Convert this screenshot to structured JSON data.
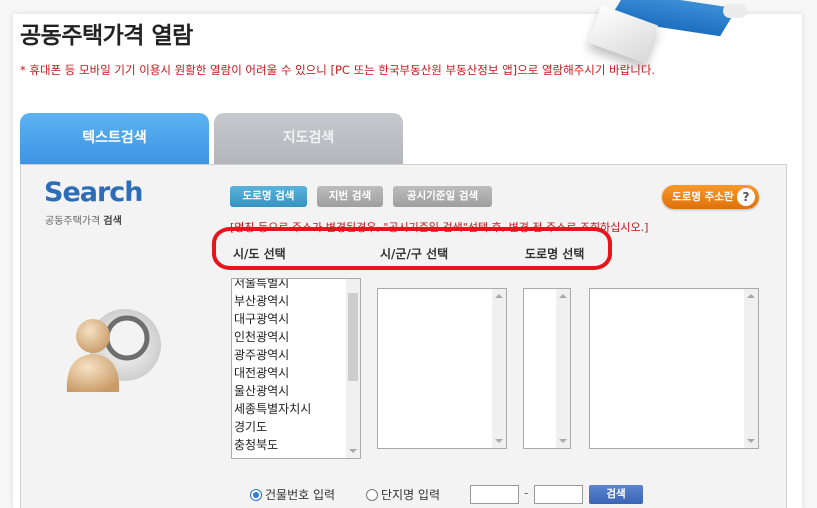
{
  "header": {
    "title": "공동주택가격 열람",
    "notice": "* 휴대폰 등 모바일 기기 이용시 원활한 열람이 어려울 수 있으니 [PC 또는 한국부동산원 부동산정보 앱]으로 열람해주시기 바랍니다."
  },
  "tabs": [
    {
      "label": "텍스트검색",
      "active": true
    },
    {
      "label": "지도검색",
      "active": false
    }
  ],
  "panel": {
    "logo_text": "Search",
    "logo_sub_light": "공동주택가격",
    "logo_sub_bold": "검색",
    "mode_buttons": [
      {
        "label": "도로명 검색",
        "active": true
      },
      {
        "label": "지번 검색",
        "active": false
      },
      {
        "label": "공시기준일 검색",
        "active": false
      }
    ],
    "road_addr_button": "도로명 주소란",
    "help_icon": "?",
    "hint": "[명칭 등으로 주소가 변경된경우, \"공시기준일 검색\"선택 후, 변경 전 주소로 조회하십시오.]",
    "columns": {
      "sido": "시/도 선택",
      "sigungu": "시/군/구 선택",
      "road": "도로명 선택"
    },
    "sido_options": [
      "서울특별시",
      "부산광역시",
      "대구광역시",
      "인천광역시",
      "광주광역시",
      "대전광역시",
      "울산광역시",
      "세종특별자치시",
      "경기도",
      "충청북도"
    ],
    "input_mode": {
      "options": [
        {
          "label": "건물번호 입력",
          "selected": true
        },
        {
          "label": "단지명 입력",
          "selected": false
        }
      ],
      "number_main": "",
      "number_sub": "",
      "separator": "-",
      "search_label": "검색"
    }
  },
  "colors": {
    "accent_blue": "#3d93e2",
    "notice_red": "#c4161c",
    "orange": "#e0700a",
    "annotation_red": "#e8141c"
  }
}
